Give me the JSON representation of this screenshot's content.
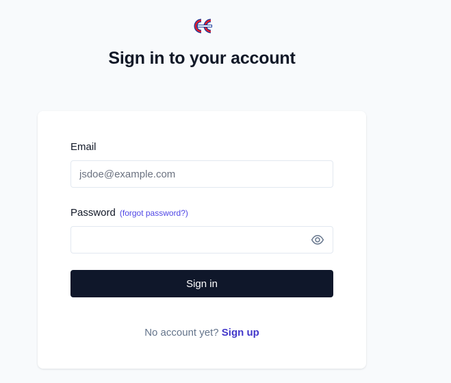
{
  "header": {
    "logo_name": "logo-icon",
    "title": "Sign in to your account"
  },
  "form": {
    "email_label": "Email",
    "email_placeholder": "jsdoe@example.com",
    "email_value": "",
    "password_label": "Password",
    "forgot_label": "(forgot password?)",
    "password_value": "",
    "show_password_icon": "eye-icon",
    "submit_label": "Sign in"
  },
  "footer": {
    "prompt": "No account yet?",
    "signup_label": "Sign up"
  },
  "colors": {
    "background": "#f8fafc",
    "card": "#ffffff",
    "primary_button": "#0f172a",
    "link": "#4f46e5",
    "text": "#111827",
    "muted": "#64748b"
  }
}
